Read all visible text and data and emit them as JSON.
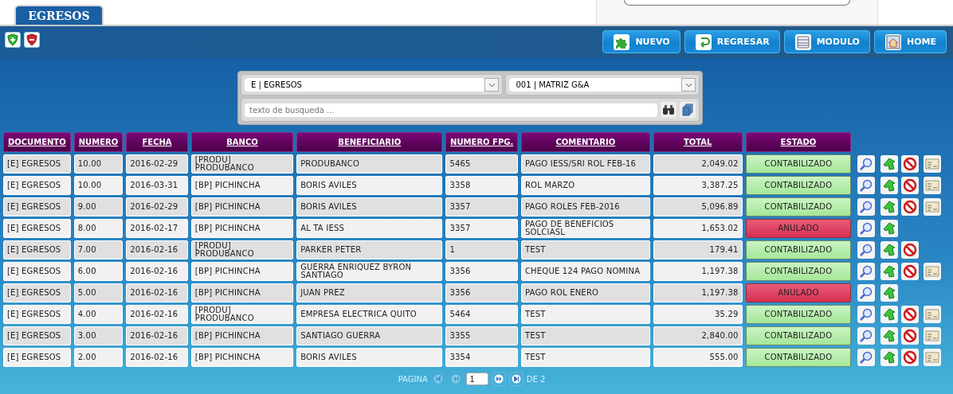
{
  "tab": {
    "label": "EGRESOS",
    "selected": true
  },
  "toolbar": {
    "buttons": [
      {
        "label": "NUEVO",
        "kind": "new"
      },
      {
        "label": "REGRESAR",
        "kind": "back"
      },
      {
        "label": "MODULO",
        "kind": "module"
      },
      {
        "label": "HOME",
        "kind": "home"
      }
    ]
  },
  "filters": {
    "type_select": "E | EGRESOS",
    "branch_select": "001 | MATRIZ G&A",
    "search": {
      "placeholder": "texto de busqueda ..."
    }
  },
  "table": {
    "columns": [
      "DOCUMENTO",
      "NUMERO",
      "FECHA",
      "BANCO",
      "BENEFICIARIO",
      "NUMERO FPG.",
      "COMENTARIO",
      "TOTAL",
      "ESTADO"
    ],
    "rows": [
      {
        "documento": "[E] EGRESOS",
        "numero": "10.00",
        "fecha": "2016-02-29",
        "banco": "[PRODU] PRODUBANCO",
        "beneficiario": "PRODUBANCO",
        "numero_fpg": "5465",
        "comentario": "PAGO IESS/SRI ROL FEB-16",
        "total": "2,049.02",
        "estado": {
          "label": "CONTABILIZADO",
          "kind": "posted"
        },
        "cancel": true,
        "print": true
      },
      {
        "documento": "[E] EGRESOS",
        "numero": "10.00",
        "fecha": "2016-03-31",
        "banco": "[BP] PICHINCHA",
        "beneficiario": "BORIS AVILES",
        "numero_fpg": "3358",
        "comentario": "ROL MARZO",
        "total": "3,387.25",
        "estado": {
          "label": "CONTABILIZADO",
          "kind": "posted"
        },
        "cancel": true,
        "print": true
      },
      {
        "documento": "[E] EGRESOS",
        "numero": "9.00",
        "fecha": "2016-02-29",
        "banco": "[BP] PICHINCHA",
        "beneficiario": "BORIS AVILES",
        "numero_fpg": "3357",
        "comentario": "PAGO ROLES FEB-2016",
        "total": "5,096.89",
        "estado": {
          "label": "CONTABILIZADO",
          "kind": "posted"
        },
        "cancel": true,
        "print": true
      },
      {
        "documento": "[E] EGRESOS",
        "numero": "8.00",
        "fecha": "2016-02-17",
        "banco": "[BP] PICHINCHA",
        "beneficiario": "AL TA IESS",
        "numero_fpg": "3357",
        "comentario": "PAGO DE BENEFICIOS SOLCIASL",
        "total": "1,653.02",
        "estado": {
          "label": "ANULADO",
          "kind": "void"
        },
        "cancel": false,
        "print": false
      },
      {
        "documento": "[E] EGRESOS",
        "numero": "7.00",
        "fecha": "2016-02-16",
        "banco": "[PRODU] PRODUBANCO",
        "beneficiario": "PARKER PETER",
        "numero_fpg": "1",
        "comentario": "TEST",
        "total": "179.41",
        "estado": {
          "label": "CONTABILIZADO",
          "kind": "posted"
        },
        "cancel": true,
        "print": false
      },
      {
        "documento": "[E] EGRESOS",
        "numero": "6.00",
        "fecha": "2016-02-16",
        "banco": "[BP] PICHINCHA",
        "beneficiario": "GUERRA ENRIQUEZ BYRON SANTIAGO",
        "numero_fpg": "3356",
        "comentario": "CHEQUE 124 PAGO NOMINA",
        "total": "1,197.38",
        "estado": {
          "label": "CONTABILIZADO",
          "kind": "posted"
        },
        "cancel": true,
        "print": true
      },
      {
        "documento": "[E] EGRESOS",
        "numero": "5.00",
        "fecha": "2016-02-16",
        "banco": "[BP] PICHINCHA",
        "beneficiario": "JUAN PREZ",
        "numero_fpg": "3356",
        "comentario": "PAGO ROL ENERO",
        "total": "1,197.38",
        "estado": {
          "label": "ANULADO",
          "kind": "void"
        },
        "cancel": false,
        "print": false
      },
      {
        "documento": "[E] EGRESOS",
        "numero": "4.00",
        "fecha": "2016-02-16",
        "banco": "[PRODU] PRODUBANCO",
        "beneficiario": "EMPRESA ELECTRICA QUITO",
        "numero_fpg": "5464",
        "comentario": "TEST",
        "total": "35.29",
        "estado": {
          "label": "CONTABILIZADO",
          "kind": "posted"
        },
        "cancel": true,
        "print": true
      },
      {
        "documento": "[E] EGRESOS",
        "numero": "3.00",
        "fecha": "2016-02-16",
        "banco": "[BP] PICHINCHA",
        "beneficiario": "SANTIAGO GUERRA",
        "numero_fpg": "3355",
        "comentario": "TEST",
        "total": "2,840.00",
        "estado": {
          "label": "CONTABILIZADO",
          "kind": "posted"
        },
        "cancel": true,
        "print": true
      },
      {
        "documento": "[E] EGRESOS",
        "numero": "2.00",
        "fecha": "2016-02-16",
        "banco": "[BP] PICHINCHA",
        "beneficiario": "BORIS AVILES",
        "numero_fpg": "3354",
        "comentario": "TEST",
        "total": "555.00",
        "estado": {
          "label": "CONTABILIZADO",
          "kind": "posted"
        },
        "cancel": true,
        "print": true
      }
    ]
  },
  "pagination": {
    "label": "PAGINA",
    "page": "1",
    "of": "DE 2",
    "nav": [
      {
        "kind": "first",
        "disabled": true
      },
      {
        "kind": "prev",
        "disabled": true
      },
      {
        "kind": "next",
        "disabled": false
      },
      {
        "kind": "last",
        "disabled": false
      }
    ]
  }
}
